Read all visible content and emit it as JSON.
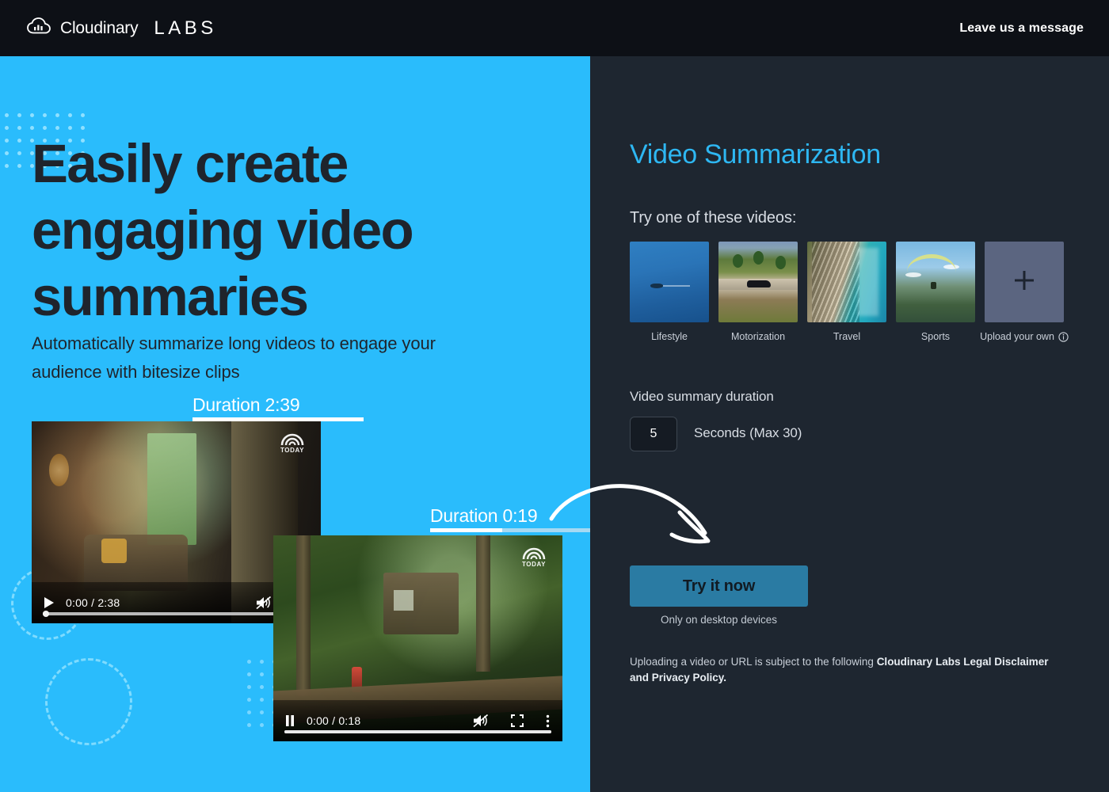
{
  "header": {
    "brand_name": "Cloudinary",
    "brand_suffix": "LABS",
    "logo_icon": "cloudinary-cloud-icon",
    "leave_message": "Leave us a message"
  },
  "hero": {
    "heading": "Easily create engaging video summaries",
    "subheading": "Automatically summarize long videos to engage your audience with bitesize clips",
    "source_duration_label": "Duration 2:39",
    "summary_duration_label": "Duration 0:19",
    "accent_color": "#2abcfc",
    "text_color": "#1f242c"
  },
  "players": {
    "source": {
      "time": "0:00 / 2:38",
      "play_icon": "play-icon",
      "mute_icon": "volume-muted-icon",
      "fullscreen_icon": "fullscreen-icon",
      "watermark": "TODAY",
      "progress_percent": 1
    },
    "summary": {
      "time": "0:00 / 0:18",
      "pause_icon": "pause-icon",
      "mute_icon": "volume-muted-icon",
      "fullscreen_icon": "fullscreen-icon",
      "more_icon": "more-vertical-icon",
      "watermark": "TODAY",
      "progress_percent": 100
    }
  },
  "panel": {
    "title": "Video Summarization",
    "title_color": "#2eb7f2",
    "videos_label": "Try one of these videos:",
    "thumbnails": [
      {
        "label": "Lifestyle",
        "art": "t-lifestyle"
      },
      {
        "label": "Motorization",
        "art": "t-motor"
      },
      {
        "label": "Travel",
        "art": "t-travel"
      },
      {
        "label": "Sports",
        "art": "t-sports"
      },
      {
        "label": "Upload your own",
        "art": "t-upload",
        "icon": "plus-icon",
        "info_icon": "info-circle-icon"
      }
    ],
    "duration_label": "Video summary duration",
    "duration_value": "5",
    "duration_unit": "Seconds (Max 30)",
    "cta_label": "Try it now",
    "cta_color": "#2a7ba3",
    "cta_note": "Only on desktop devices",
    "legal_prefix": "Uploading a video or URL is subject to the following ",
    "legal_link": "Cloudinary Labs Legal Disclaimer and Privacy Policy."
  }
}
